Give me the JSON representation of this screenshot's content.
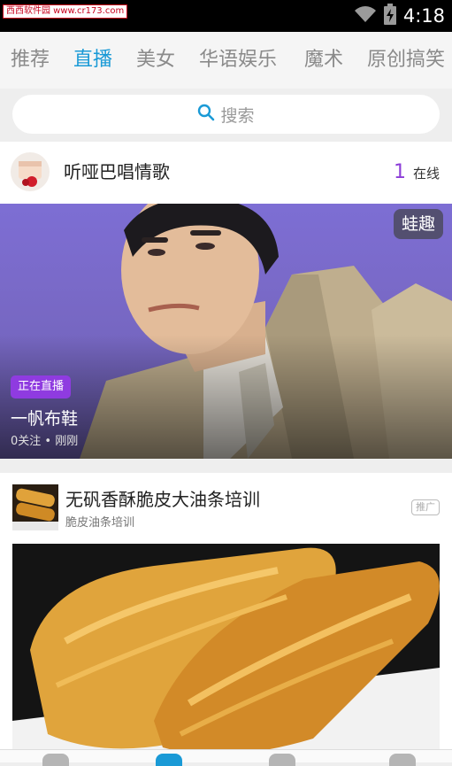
{
  "status_bar": {
    "watermark": "西西软件园 www.cr173.com",
    "time": "4:18"
  },
  "tabs": [
    {
      "label": "推荐",
      "active": false
    },
    {
      "label": "直播",
      "active": true
    },
    {
      "label": "美女",
      "active": false
    },
    {
      "label": "华语娱乐",
      "active": false
    },
    {
      "label": "魔术",
      "active": false
    },
    {
      "label": "原创搞笑",
      "active": false
    }
  ],
  "search": {
    "placeholder": "搜索"
  },
  "live_card": {
    "host_name": "听哑巴唱情歌",
    "online_count": "1",
    "online_label": "在线",
    "source_badge": "蛙趣",
    "live_badge": "正在直播",
    "title": "一帆布鞋",
    "meta": "0关注 • 刚刚"
  },
  "ad_card": {
    "title": "无矾香酥脆皮大油条培训",
    "subtitle": "脆皮油条培训",
    "tag": "推广"
  },
  "colors": {
    "accent": "#1a9ad6",
    "live_purple": "#8f3be0",
    "online_purple": "#8c3dd8"
  }
}
